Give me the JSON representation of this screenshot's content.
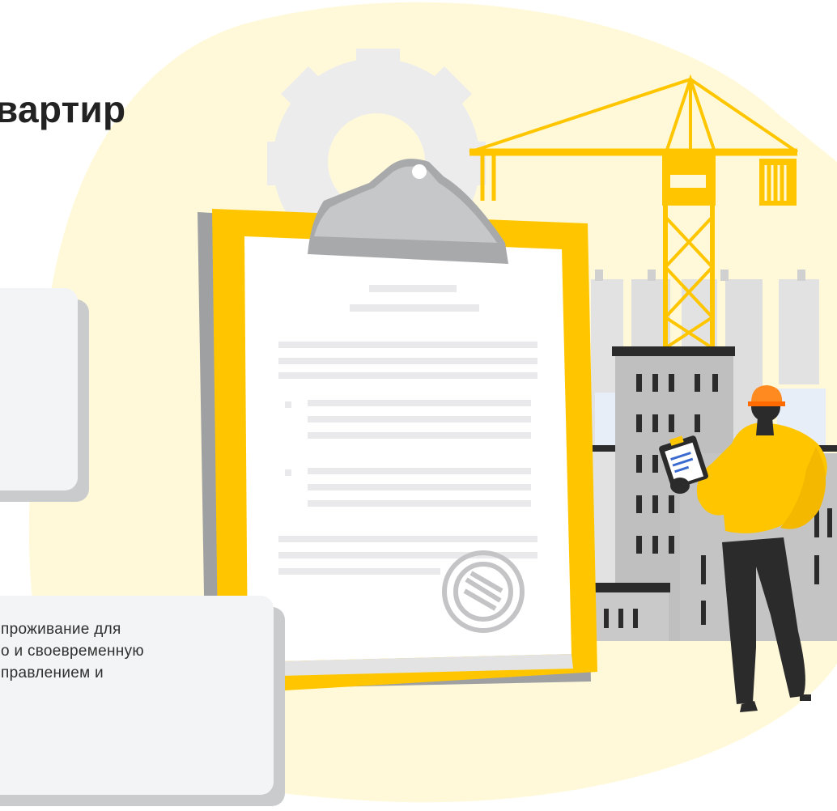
{
  "hero": {
    "title": "вартир"
  },
  "info_card": {
    "text": "проживание для\nо и своевременную\nправлением и"
  },
  "illustration": {
    "icons": [
      "gear-icon",
      "crane-icon",
      "clipboard-icon",
      "stamp-icon",
      "worker-icon",
      "buildings-icon"
    ]
  },
  "colors": {
    "accent_yellow": "#ffc600",
    "blob_background": "#fff9d9",
    "gear_gray": "#ececed",
    "building_gray": "#bfbfbf",
    "text_dark": "#222222"
  }
}
